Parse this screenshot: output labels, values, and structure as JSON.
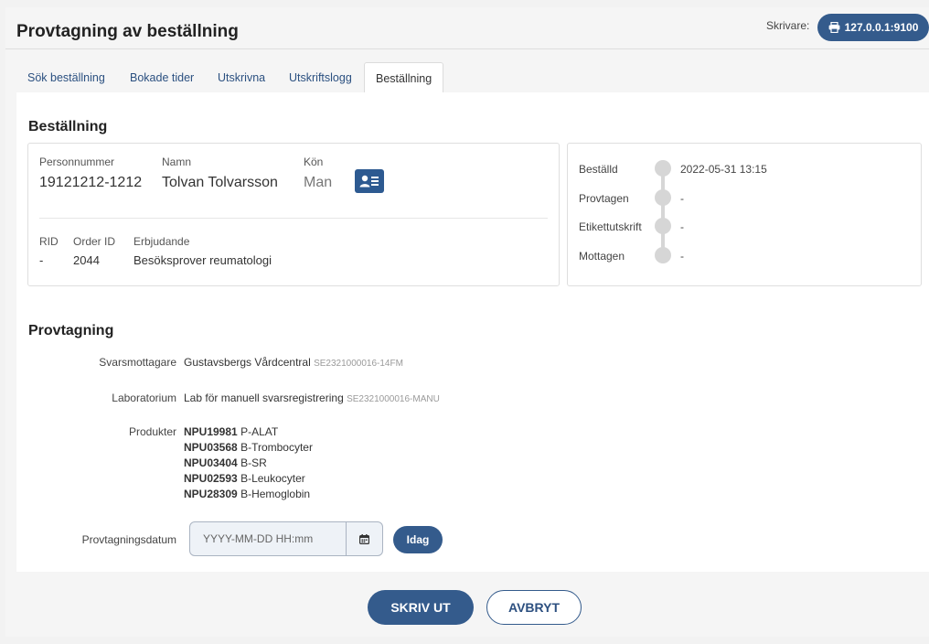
{
  "header": {
    "title": "Provtagning av beställning",
    "printer_label": "Skrivare:",
    "printer_value": "127.0.0.1:9100"
  },
  "tabs": [
    {
      "label": "Sök beställning"
    },
    {
      "label": "Bokade tider"
    },
    {
      "label": "Utskrivna"
    },
    {
      "label": "Utskriftslogg"
    },
    {
      "label": "Beställning",
      "active": true
    }
  ],
  "order": {
    "section_title": "Beställning",
    "personnummer_label": "Personnummer",
    "personnummer": "19121212-1212",
    "namn_label": "Namn",
    "namn": "Tolvan Tolvarsson",
    "kon_label": "Kön",
    "kon": "Man",
    "rid_label": "RID",
    "rid": "-",
    "order_id_label": "Order ID",
    "order_id": "2044",
    "erbjudande_label": "Erbjudande",
    "erbjudande": "Besöksprover reumatologi"
  },
  "timeline": [
    {
      "label": "Beställd",
      "value": "2022-05-31 13:15"
    },
    {
      "label": "Provtagen",
      "value": "-"
    },
    {
      "label": "Etikettutskrift",
      "value": "-"
    },
    {
      "label": "Mottagen",
      "value": "-"
    }
  ],
  "sampling": {
    "section_title": "Provtagning",
    "svarsmottagare_label": "Svarsmottagare",
    "svarsmottagare": "Gustavsbergs Vårdcentral",
    "svarsmottagare_code": "SE2321000016-14FM",
    "laboratorium_label": "Laboratorium",
    "laboratorium": "Lab för manuell svarsregistrering",
    "laboratorium_code": "SE2321000016-MANU",
    "produkter_label": "Produkter",
    "produkter": [
      {
        "code": "NPU19981",
        "name": "P-ALAT"
      },
      {
        "code": "NPU03568",
        "name": "B-Trombocyter"
      },
      {
        "code": "NPU03404",
        "name": "B-SR"
      },
      {
        "code": "NPU02593",
        "name": "B-Leukocyter"
      },
      {
        "code": "NPU28309",
        "name": "B-Hemoglobin"
      }
    ],
    "datum_label": "Provtagningsdatum",
    "datum_placeholder": "YYYY-MM-DD HH:mm",
    "today_label": "Idag"
  },
  "actions": {
    "print_label": "SKRIV UT",
    "cancel_label": "AVBRYT"
  },
  "colors": {
    "primary": "#345b8c",
    "timeline_dot": "#d6d6d6"
  }
}
